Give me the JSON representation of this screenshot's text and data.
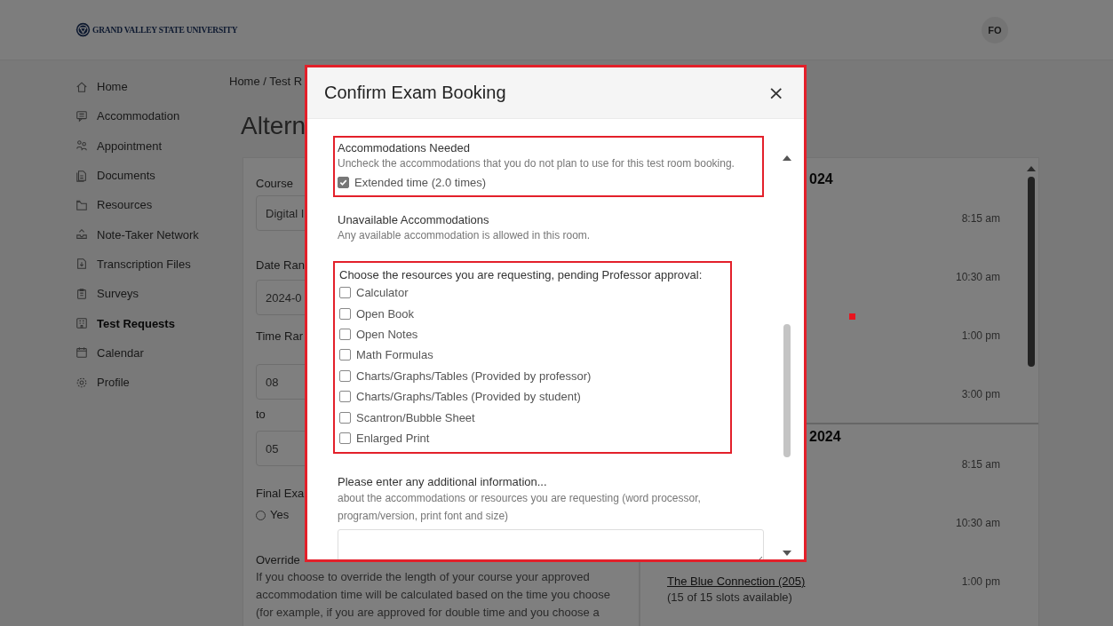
{
  "header": {
    "logo": "GRAND VALLEY STATE UNIVERSITY",
    "avatar": "FO"
  },
  "sidebar": {
    "items": [
      {
        "label": "Home",
        "selected": false
      },
      {
        "label": "Accommodation",
        "selected": false
      },
      {
        "label": "Appointment",
        "selected": false
      },
      {
        "label": "Documents",
        "selected": false
      },
      {
        "label": "Resources",
        "selected": false
      },
      {
        "label": "Note-Taker Network",
        "selected": false
      },
      {
        "label": "Transcription Files",
        "selected": false
      },
      {
        "label": "Surveys",
        "selected": false
      },
      {
        "label": "Test Requests",
        "selected": true
      },
      {
        "label": "Calendar",
        "selected": false
      },
      {
        "label": "Profile",
        "selected": false
      }
    ]
  },
  "breadcrumb": "Home / Test R",
  "page_title": "Altern",
  "form": {
    "course_label": "Course",
    "course_value": "Digital I",
    "date_label": "Date Ran",
    "date_value": "2024-0",
    "time_label": "Time Rar",
    "time_from": "08",
    "to_label": "to",
    "time_to": "05",
    "final_label": "Final Exa",
    "final_option": {
      "label": "Yes",
      "selected": false
    },
    "override_label": "Override",
    "override_text": "If you choose to override the length of your course your approved accommodation time will be calculated based on the time you choose (for example, if you are approved for double time and you choose a"
  },
  "schedule": {
    "days": [
      {
        "date": "024",
        "slots": [
          {
            "time": "8:15 am"
          },
          {
            "time": "10:30 am"
          },
          {
            "time": "1:00 pm"
          },
          {
            "time": "3:00 pm"
          }
        ]
      },
      {
        "date": "2024",
        "slots": [
          {
            "time": "8:15 am"
          },
          {
            "time": "10:30 am"
          },
          {
            "time": "1:00 pm",
            "room": "The Blue Connection (205)",
            "availability": "(15 of 15 slots available)"
          }
        ]
      }
    ]
  },
  "dialog": {
    "title": "Confirm Exam Booking",
    "close": "×",
    "accommodations": {
      "heading": "Accommodations Needed",
      "hint": "Uncheck the accommodations that you do not plan to use for this test room booking.",
      "items": [
        {
          "label": "Extended time (2.0 times)",
          "checked": true
        }
      ]
    },
    "unavailable": {
      "heading": "Unavailable Accommodations",
      "text": "Any available accommodation is allowed in this room."
    },
    "resources": {
      "heading": "Choose the resources you are requesting, pending Professor approval:",
      "items": [
        {
          "label": "Calculator",
          "checked": false
        },
        {
          "label": "Open Book",
          "checked": false
        },
        {
          "label": "Open Notes",
          "checked": false
        },
        {
          "label": "Math Formulas",
          "checked": false
        },
        {
          "label": "Charts/Graphs/Tables (Provided by professor)",
          "checked": false
        },
        {
          "label": "Charts/Graphs/Tables (Provided by student)",
          "checked": false
        },
        {
          "label": "Scantron/Bubble Sheet",
          "checked": false
        },
        {
          "label": "Enlarged Print",
          "checked": false
        }
      ]
    },
    "additional": {
      "heading": "Please enter any additional information...",
      "hint": "about the accommodations or resources you are requesting (word processor, program/version, print font and size)"
    }
  }
}
